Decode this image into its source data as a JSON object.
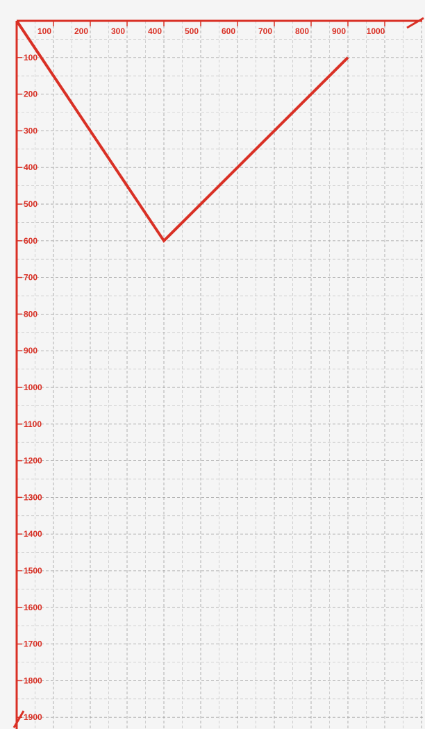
{
  "chart_data": {
    "type": "line",
    "title": "",
    "xlabel": "",
    "ylabel": "",
    "xlim": [
      0,
      1050
    ],
    "ylim": [
      0,
      1900
    ],
    "y_inverted": true,
    "grid": true,
    "grid_style": "dashed",
    "x_ticks": [
      100,
      200,
      300,
      400,
      500,
      600,
      700,
      800,
      900,
      1000
    ],
    "y_ticks": [
      100,
      200,
      300,
      400,
      500,
      600,
      700,
      800,
      900,
      1000,
      1100,
      1200,
      1300,
      1400,
      1500,
      1600,
      1700,
      1800,
      1900
    ],
    "series": [
      {
        "x": [
          0,
          400,
          900
        ],
        "y": [
          0,
          600,
          100
        ]
      }
    ]
  },
  "colors": {
    "background": "#f5f5f5",
    "axis": "#d93025",
    "series": "#d93025",
    "grid": "#9e9e9e"
  }
}
